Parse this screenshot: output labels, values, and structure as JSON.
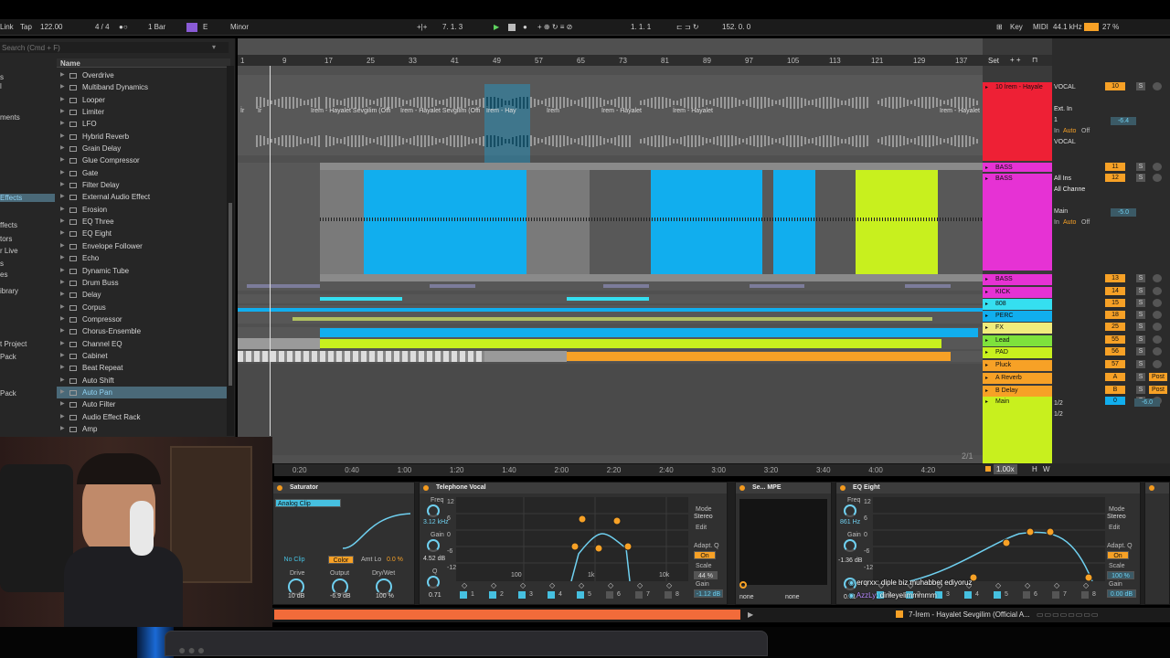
{
  "toolbar": {
    "left1": "Link",
    "tap": "Tap",
    "tempo": "122.00",
    "sig": "4 / 4",
    "quant": "1 Bar",
    "key_root": "E",
    "scale": "Minor",
    "pos": "7.  1.  3",
    "loop_start": "1.  1.  1",
    "loop_len": "152.  0.  0",
    "key_btn": "Key",
    "midi_btn": "MIDI",
    "samplerate": "44.1 kHz",
    "cpu": "27 %"
  },
  "browser": {
    "search": "Search (Cmd + F)",
    "name_header": "Name",
    "sidebar": [
      "s",
      "l",
      "ments",
      "Effects",
      "ffects",
      "tors",
      "r Live",
      "s",
      "es",
      "ibrary",
      "t Project",
      "Pack",
      "Pack"
    ],
    "items": [
      "Overdrive",
      "Multiband Dynamics",
      "Looper",
      "Limiter",
      "LFO",
      "Hybrid Reverb",
      "Grain Delay",
      "Glue Compressor",
      "Gate",
      "Filter Delay",
      "External Audio Effect",
      "Erosion",
      "EQ Three",
      "EQ Eight",
      "Envelope Follower",
      "Echo",
      "Dynamic Tube",
      "Drum Buss",
      "Delay",
      "Corpus",
      "Compressor",
      "Chorus-Ensemble",
      "Channel EQ",
      "Cabinet",
      "Beat Repeat",
      "Auto Shift",
      "Auto Pan",
      "Auto Filter",
      "Audio Effect Rack",
      "Amp"
    ],
    "selected_index": 26
  },
  "ruler": {
    "bars": [
      "1",
      "9",
      "17",
      "25",
      "33",
      "41",
      "49",
      "57",
      "65",
      "73",
      "81",
      "89",
      "97",
      "105",
      "113",
      "121",
      "129",
      "137"
    ],
    "set": "Set"
  },
  "time_ruler": [
    "0:20",
    "0:40",
    "1:00",
    "1:20",
    "1:40",
    "2:00",
    "2:20",
    "2:40",
    "3:00",
    "3:20",
    "3:40",
    "4:00",
    "4:20"
  ],
  "page_indicator": "2/1",
  "zoom": "1.00x",
  "hw": [
    "H",
    "W"
  ],
  "clips": {
    "vocal_names": [
      "İr",
      "İr",
      "İrem - Hayalet Sevgilim (Offi",
      "İrem - Hayalet Sevgilim (Offi",
      "İrem - Hay",
      "İrem",
      "İrem - Hayalet",
      "İrem - Hayalet",
      "İrem - Hayalet"
    ]
  },
  "tracks": [
    {
      "name": "10 İrem - Hayale",
      "color": "#ee2035",
      "num": "10",
      "io_in": "Ext. In",
      "io_ch": "1",
      "io_out": "VOCAL",
      "vol": "-6.4",
      "label": "VOCAL"
    },
    {
      "name": "BASS",
      "color": "#e632d4",
      "num": "11"
    },
    {
      "name": "BASS",
      "color": "#e632d4",
      "num": "12",
      "io_in": "All Ins",
      "io_ch": "All Channe",
      "io_out": "Main",
      "vol": "-5.0"
    },
    {
      "name": "BASS",
      "color": "#e632d4",
      "num": "13"
    },
    {
      "name": "KICK",
      "color": "#e632d4",
      "num": "14"
    },
    {
      "name": "808",
      "color": "#35dff0",
      "num": "15"
    },
    {
      "name": "PERC",
      "color": "#11aeee",
      "num": "18"
    },
    {
      "name": "FX",
      "color": "#f0ec7c",
      "num": "25"
    },
    {
      "name": "Lead",
      "color": "#7ee23c",
      "num": "55"
    },
    {
      "name": "PAD",
      "color": "#c8f01e",
      "num": "56"
    },
    {
      "name": "Pluck",
      "color": "#f7a126",
      "num": "57"
    },
    {
      "name": "A Reverb",
      "color": "#f7a126",
      "num": "A",
      "send": "Post"
    },
    {
      "name": "B Delay",
      "color": "#f7a126",
      "num": "B",
      "send": "Post"
    },
    {
      "name": "Main",
      "color": "#c8f01e",
      "num": "0",
      "vol": "-6.0",
      "half1": "1/2",
      "half2": "1/2"
    }
  ],
  "mixer_labels": {
    "in": "In",
    "auto": "Auto",
    "off": "Off",
    "s": "S",
    "c": "C"
  },
  "devices": {
    "saturator": {
      "title": "Saturator",
      "mode": "Analog Clip",
      "noclip": "No Clip",
      "color": "Color",
      "amt": "Amt Lo",
      "amt_val": "0.0 %",
      "drive_l": "Drive",
      "drive_v": "10 dB",
      "out_l": "Output",
      "out_v": "-6.9 dB",
      "dw_l": "Dry/Wet",
      "dw_v": "100 %"
    },
    "telephone": {
      "title": "Telephone Vocal",
      "freq_l": "Freq",
      "freq_v": "3.12 kHz",
      "gain_l": "Gain",
      "gain_v": "4.52 dB",
      "q_l": "Q",
      "q_v": "0.71",
      "mode_l": "Mode",
      "mode_v": "Stereo",
      "edit": "Edit",
      "adapt": "Adapt. Q",
      "on": "On",
      "scale_l": "Scale",
      "scale_v": "44 %",
      "gain2_l": "Gain",
      "gain2_v": "-1.12 dB",
      "y": [
        "12",
        "6",
        "0",
        "-6",
        "-12"
      ],
      "x": [
        "100",
        "1k",
        "10k"
      ],
      "bands": [
        "1",
        "2",
        "3",
        "4",
        "5",
        "6",
        "7",
        "8"
      ]
    },
    "se": {
      "title": "Se... MPE",
      "none1": "none",
      "none2": "none"
    },
    "eq8": {
      "title": "EQ Eight",
      "freq_l": "Freq",
      "freq_v": "861 Hz",
      "gain_l": "Gain",
      "gain_v": "-1.36 dB",
      "q_v": "0.71",
      "mode_l": "Mode",
      "mode_v": "Stereo",
      "edit": "Edit",
      "adapt": "Adapt. Q",
      "on": "On",
      "scale_l": "Scale",
      "scale_v": "100 %",
      "gain2_l": "Gain",
      "gain2_v": "0.00 dB",
      "y": [
        "12",
        "6",
        "0",
        "-6",
        "-12"
      ],
      "bands": [
        "1",
        "2",
        "3",
        "4",
        "5",
        "6",
        "7",
        "8"
      ]
    }
  },
  "chat": [
    {
      "user": "erqrxx",
      "msg": ": diple biz muhabbet ediyoruz"
    },
    {
      "user": "AzzLy",
      "msg": ": dinleyelimmmmm"
    }
  ],
  "status": {
    "clip_name": "7-İrem - Hayalet Sevgilim (Official A..."
  },
  "colors": {
    "accent": "#f7a126",
    "blue": "#11aeee",
    "lime": "#c8f01e",
    "red": "#ee2035",
    "pink": "#e632d4"
  }
}
